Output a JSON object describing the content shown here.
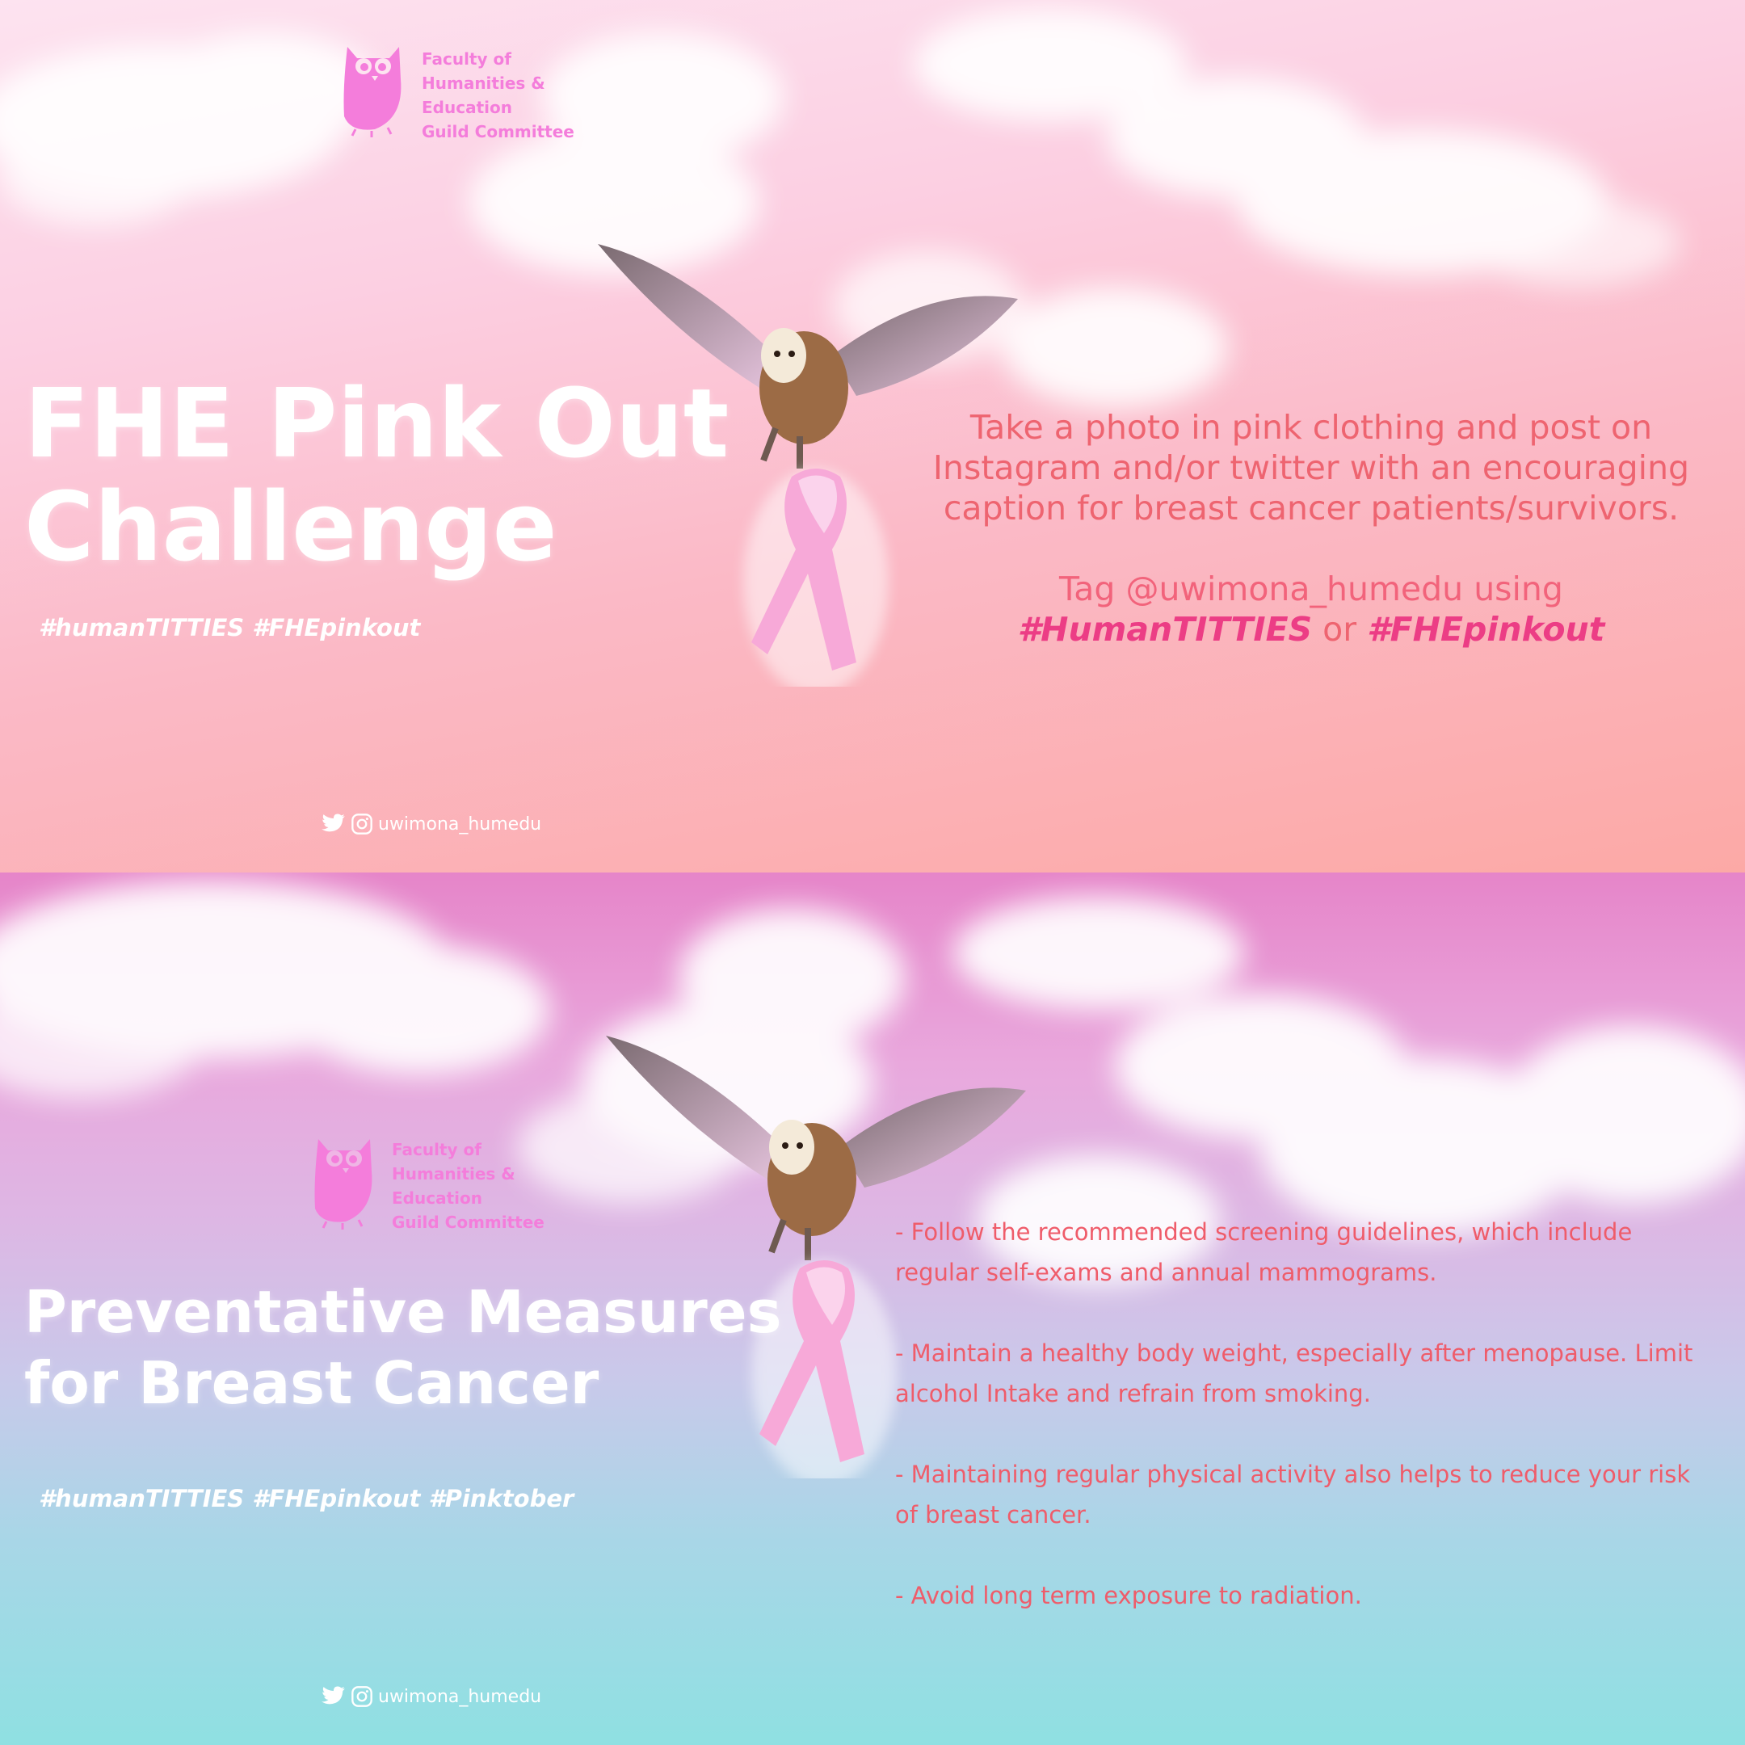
{
  "colors": {
    "logo_pink": "#f47ddb",
    "description_coral": "#ee6470",
    "hashtag_strong": "#ec3d85",
    "title_white": "#ffffff"
  },
  "panel_top": {
    "logo_text": "Faculty of\nHumanities &\nEducation\nGuild Committee",
    "title": "FHE Pink Out\nChallenge",
    "hashtags": "#humanTITTIES #FHEpinkout",
    "description_lines": [
      "Take a photo in pink clothing and post on",
      "Instagram and/or twitter with an encouraging",
      "caption for breast cancer patients/survivors."
    ],
    "tag_prefix": "Tag @uwimona_humedu using",
    "tag_hashtag_1": "#HumanTITTIES",
    "tag_or": " or ",
    "tag_hashtag_2": "#FHEpinkout",
    "social_handle": "uwimona_humedu",
    "icons": [
      "owl-logo-icon",
      "twitter-icon",
      "instagram-icon",
      "owl-with-ribbon-icon"
    ]
  },
  "panel_bottom": {
    "logo_text": "Faculty of\nHumanities &\nEducation\nGuild Committee",
    "title": "Preventative Measures\nfor Breast Cancer",
    "hashtags": "#humanTITTIES #FHEpinkout #Pinktober",
    "tips": [
      "- Follow the recommended screening guidelines, which include regular self-exams and annual mammograms.",
      "- Maintain a healthy body weight, especially after menopause. Limit alcohol Intake and refrain from smoking.",
      "- Maintaining regular physical activity also helps to reduce your risk of breast cancer.",
      "- Avoid long term exposure to radiation."
    ],
    "social_handle": "uwimona_humedu",
    "icons": [
      "owl-logo-icon",
      "twitter-icon",
      "instagram-icon",
      "owl-with-ribbon-icon"
    ]
  }
}
